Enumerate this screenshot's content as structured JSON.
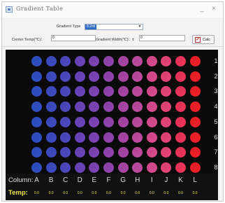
{
  "window": {
    "title": "Gradient Table",
    "minimize": "_",
    "close": "×"
  },
  "form": {
    "gradient_type_label": "Gradient Type",
    "gradient_type_value": "8.2ml",
    "center_temp_label": "Center Temp(℃)：",
    "center_temp_value": "0",
    "gradient_width_label": "Gradient Width(℃)：±",
    "gradient_width_value": "0",
    "calc_label": "Calc"
  },
  "plate": {
    "columns": [
      "A",
      "B",
      "C",
      "D",
      "E",
      "F",
      "G",
      "H",
      "I",
      "J",
      "K",
      "L"
    ],
    "rows": [
      "1",
      "2",
      "3",
      "4",
      "5",
      "6",
      "7",
      "8"
    ],
    "column_colors": [
      "#2f4fc4",
      "#3d4bc2",
      "#4d48c0",
      "#6a44bb",
      "#7d44b6",
      "#9244ae",
      "#a845a6",
      "#be4a9e",
      "#d94a8e",
      "#e64478",
      "#ee335a",
      "#f21f28"
    ]
  },
  "footer": {
    "column_label": "Column:",
    "temp_label": "Temp:",
    "temps": [
      "0.0",
      "0.0",
      "0.0",
      "0.0",
      "0.0",
      "0.0",
      "0.0",
      "0.0",
      "0.0",
      "0.0",
      "0.0",
      "0.0"
    ],
    "column_label_color": "#e0e0e0",
    "temp_label_color": "#f0e84a"
  }
}
